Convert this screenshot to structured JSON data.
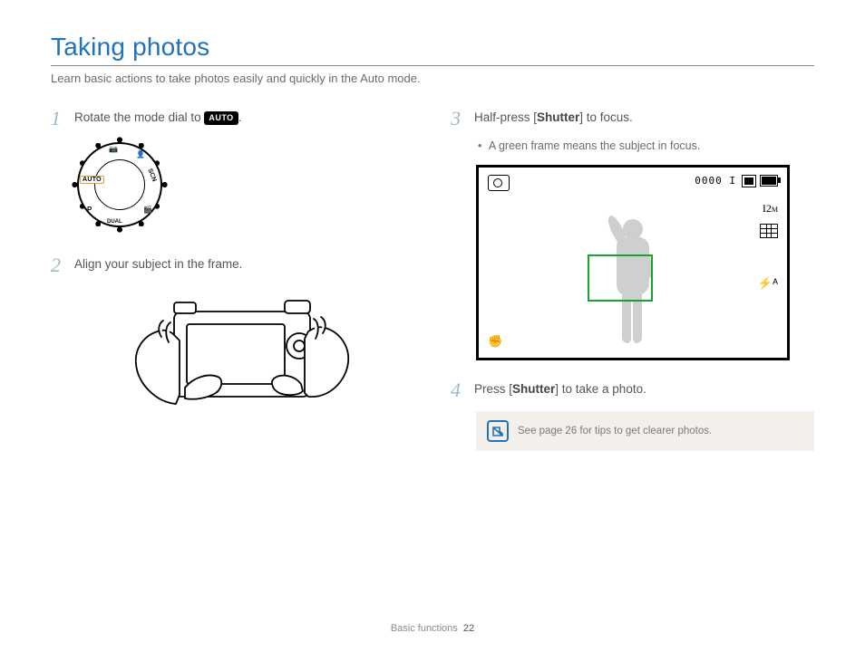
{
  "title": "Taking photos",
  "subtitle": "Learn basic actions to take photos easily and quickly in the Auto mode.",
  "steps": {
    "s1": {
      "num": "1",
      "pre": "Rotate the mode dial to ",
      "badge": "AUTO",
      "post": "."
    },
    "s2": {
      "num": "2",
      "text": "Align your subject in the frame."
    },
    "s3": {
      "num": "3",
      "pre": "Half-press [",
      "bold": "Shutter",
      "post": "] to focus.",
      "bullet": "A green frame means the subject in focus."
    },
    "s4": {
      "num": "4",
      "pre": "Press [",
      "bold": "Shutter",
      "post": "] to take a photo."
    }
  },
  "dial": {
    "auto": "AUTO",
    "p": "P",
    "dual": "DUAL",
    "scn": "SCN"
  },
  "lcd": {
    "counter": "0000 I",
    "mp": "I2",
    "mp_suffix": "M",
    "flash": "⚡ᴬ",
    "steady": "✊"
  },
  "tip": "See page 26 for tips to get clearer photos.",
  "footer": {
    "section": "Basic functions",
    "page": "22"
  }
}
